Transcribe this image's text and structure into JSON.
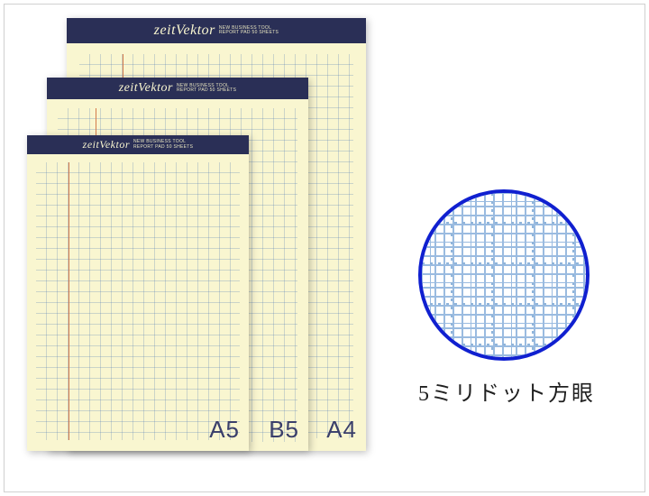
{
  "brand": "zeitVektor",
  "tagline_line1": "NEW BUSINESS TOOL",
  "tagline_line2": "REPORT PAD 50 SHEETS",
  "pads": [
    {
      "key": "a4",
      "size_label": "A4"
    },
    {
      "key": "b5",
      "size_label": "B5"
    },
    {
      "key": "a5",
      "size_label": "A5"
    }
  ],
  "swatch_caption": "5ミリドット方眼"
}
